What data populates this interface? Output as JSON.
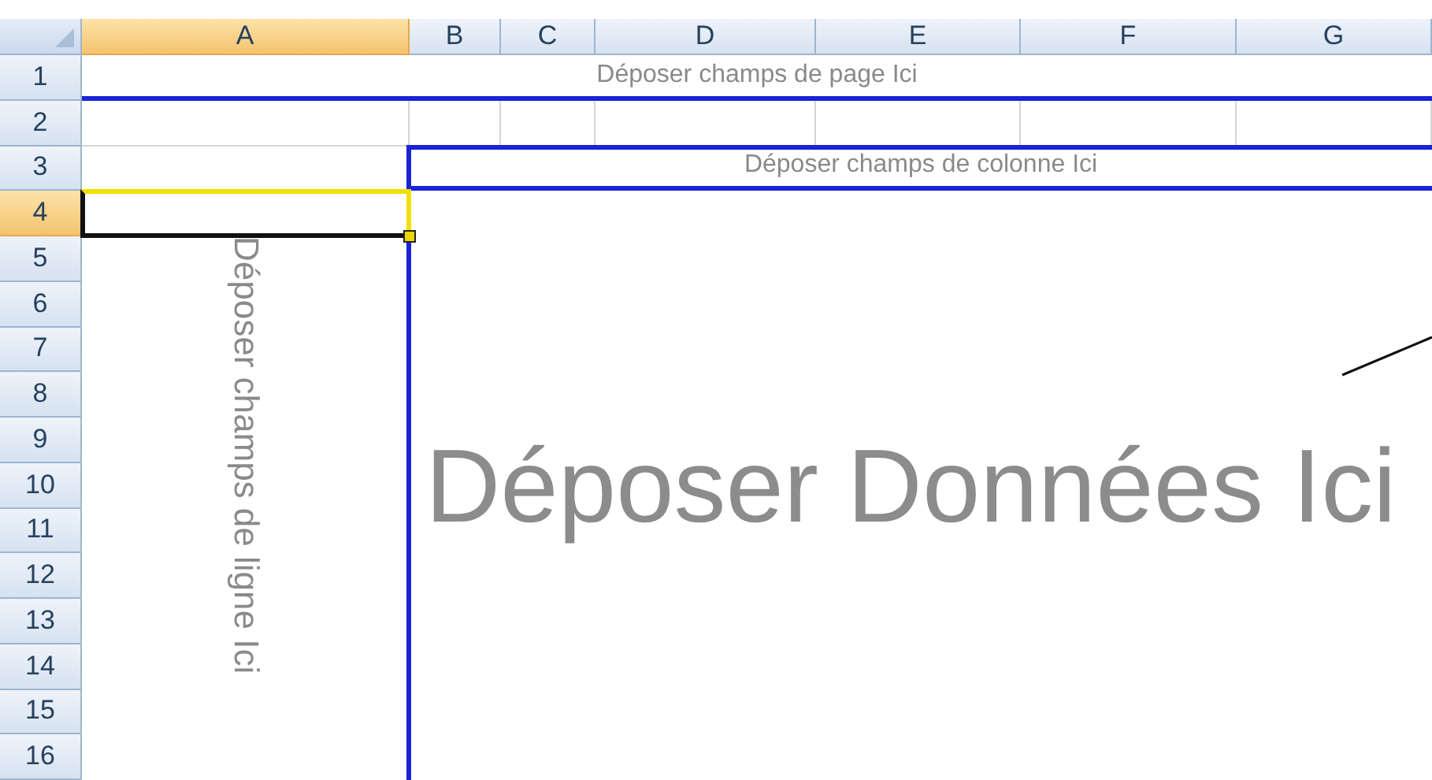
{
  "column_headers": [
    {
      "label": "A",
      "selected": true
    },
    {
      "label": "B",
      "selected": false
    },
    {
      "label": "C",
      "selected": false
    },
    {
      "label": "D",
      "selected": false
    },
    {
      "label": "E",
      "selected": false
    },
    {
      "label": "F",
      "selected": false
    },
    {
      "label": "G",
      "selected": false
    }
  ],
  "row_headers": [
    {
      "label": "1",
      "selected": false
    },
    {
      "label": "2",
      "selected": false
    },
    {
      "label": "3",
      "selected": false
    },
    {
      "label": "4",
      "selected": true
    },
    {
      "label": "5",
      "selected": false
    },
    {
      "label": "6",
      "selected": false
    },
    {
      "label": "7",
      "selected": false
    },
    {
      "label": "8",
      "selected": false
    },
    {
      "label": "9",
      "selected": false
    },
    {
      "label": "10",
      "selected": false
    },
    {
      "label": "11",
      "selected": false
    },
    {
      "label": "12",
      "selected": false
    },
    {
      "label": "13",
      "selected": false
    },
    {
      "label": "14",
      "selected": false
    },
    {
      "label": "15",
      "selected": false
    },
    {
      "label": "16",
      "selected": false
    }
  ],
  "pivot": {
    "page_drop": "Déposer champs de page Ici",
    "column_drop": "Déposer champs de colonne Ici",
    "row_drop": "Déposer champs de ligne Ici",
    "data_drop": "Déposer Données Ici"
  }
}
